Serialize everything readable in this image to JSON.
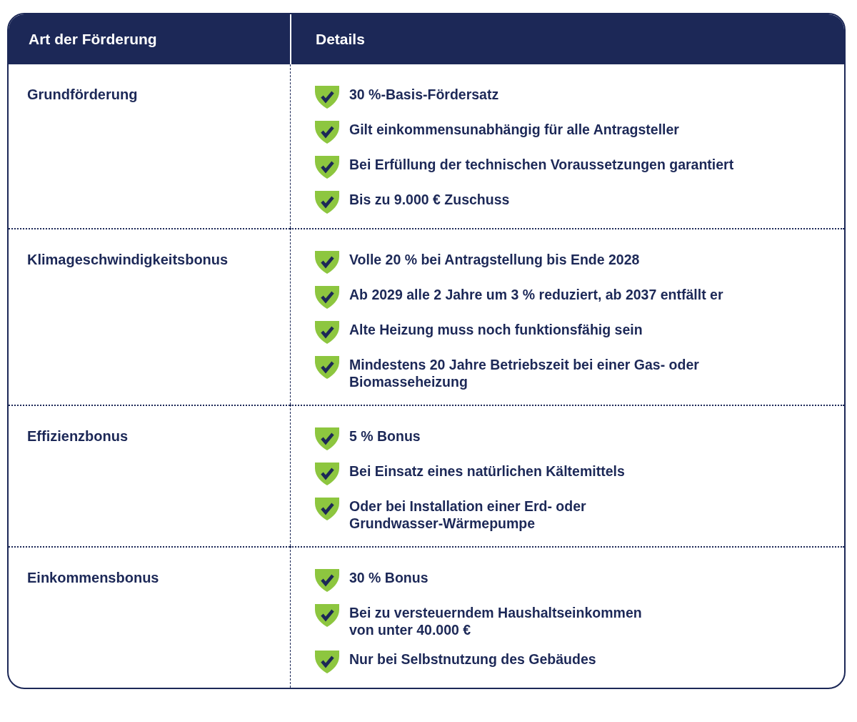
{
  "table": {
    "columns": [
      "Art der Förderung",
      "Details"
    ],
    "rows": [
      {
        "type": "Grundförderung",
        "details": [
          "30 %-Basis-Fördersatz",
          "Gilt einkommensunabhängig für alle Antragsteller",
          "Bei Erfüllung der technischen Voraussetzungen garantiert",
          "Bis zu 9.000 € Zuschuss"
        ]
      },
      {
        "type": "Klimageschwindigkeitsbonus",
        "details": [
          "Volle 20 % bei Antragstellung bis Ende 2028",
          "Ab 2029 alle 2 Jahre um 3 % reduziert, ab 2037 entfällt er",
          "Alte Heizung muss noch funktionsfähig sein",
          "Mindestens 20 Jahre Betriebszeit bei einer Gas- oder\nBiomasseheizung"
        ]
      },
      {
        "type": "Effizienzbonus",
        "details": [
          "5 % Bonus",
          "Bei Einsatz eines natürlichen Kältemittels",
          "Oder bei Installation einer Erd- oder\nGrundwasser-Wärmepumpe"
        ]
      },
      {
        "type": "Einkommensbonus",
        "details": [
          "30 % Bonus",
          "Bei zu versteuerndem Haushaltseinkommen\nvon unter 40.000 €",
          "Nur bei Selbstnutzung des Gebäudes"
        ]
      }
    ]
  }
}
